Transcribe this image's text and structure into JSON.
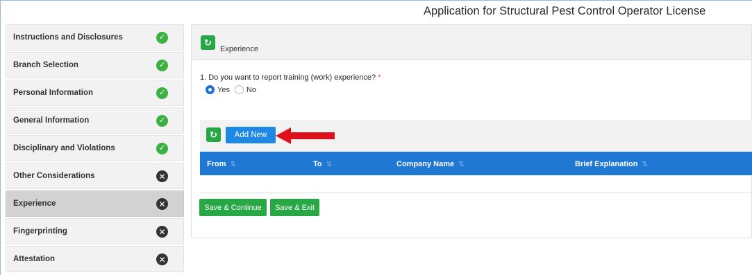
{
  "page": {
    "title": "Application for Structural Pest Control Operator License"
  },
  "sidebar": {
    "items": [
      {
        "label": "Instructions and Disclosures",
        "status": "complete"
      },
      {
        "label": "Branch Selection",
        "status": "complete"
      },
      {
        "label": "Personal Information",
        "status": "complete"
      },
      {
        "label": "General Information",
        "status": "complete"
      },
      {
        "label": "Disciplinary and Violations",
        "status": "complete"
      },
      {
        "label": "Other Considerations",
        "status": "incomplete"
      },
      {
        "label": "Experience",
        "status": "incomplete",
        "active": true
      },
      {
        "label": "Fingerprinting",
        "status": "incomplete"
      },
      {
        "label": "Attestation",
        "status": "incomplete"
      }
    ],
    "complete_icon": "check-icon",
    "incomplete_icon": "x-icon"
  },
  "main": {
    "section_title": "Experience",
    "question": {
      "text": "1. Do you want to report training (work) experience?",
      "required_marker": "*",
      "options": [
        {
          "label": "Yes",
          "selected": true
        },
        {
          "label": "No",
          "selected": false
        }
      ]
    },
    "grid": {
      "add_button": "Add New",
      "columns": [
        "From",
        "To",
        "Company Name",
        "Brief Explanation"
      ],
      "rows": []
    },
    "buttons": {
      "save_continue": "Save & Continue",
      "save_exit": "Save & Exit"
    }
  },
  "colors": {
    "complete": "#3cb043",
    "incomplete": "#333333",
    "accent_blue": "#1e78d4",
    "green_button": "#28a745",
    "annotation_arrow": "#e0101a"
  }
}
